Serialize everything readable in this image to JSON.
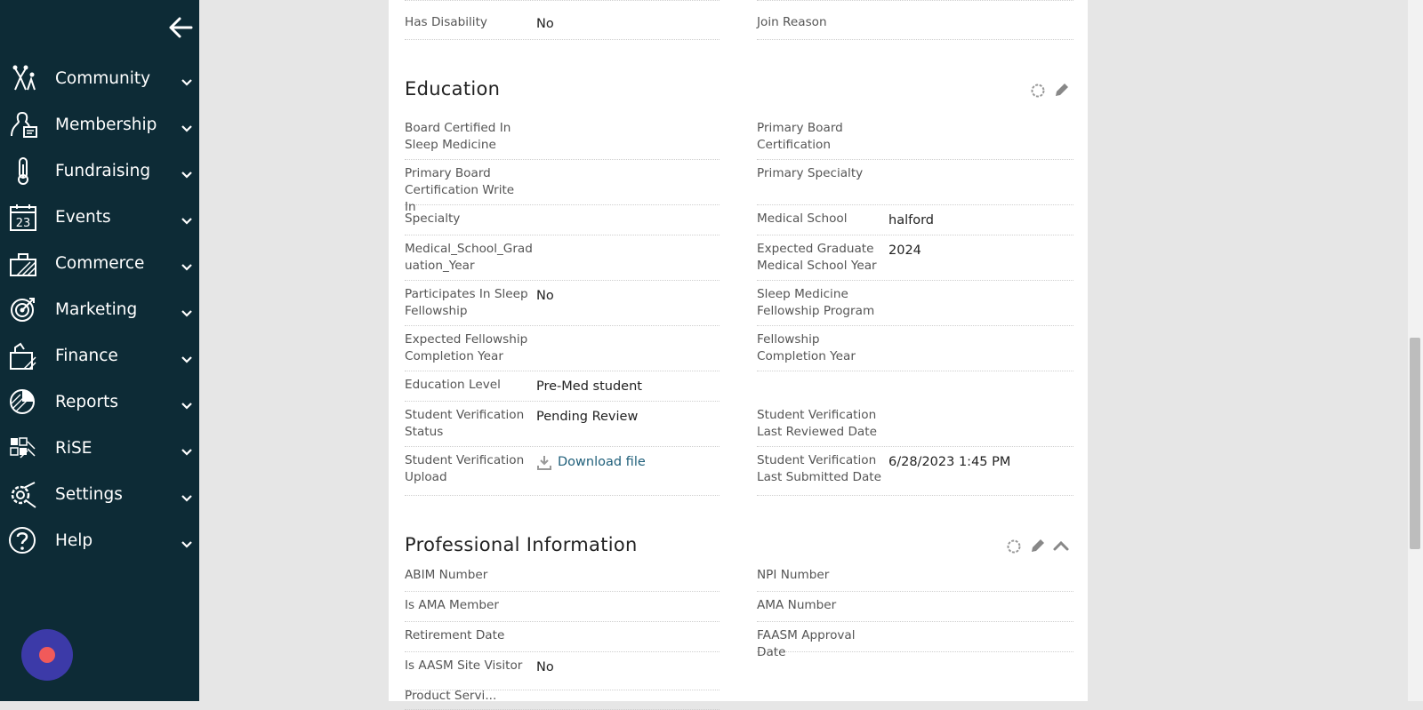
{
  "sidebar": {
    "items": [
      {
        "label": "Community",
        "icon": "community-icon"
      },
      {
        "label": "Membership",
        "icon": "membership-icon"
      },
      {
        "label": "Fundraising",
        "icon": "fundraising-icon"
      },
      {
        "label": "Events",
        "icon": "calendar-icon",
        "icon_text": "23"
      },
      {
        "label": "Commerce",
        "icon": "commerce-icon"
      },
      {
        "label": "Marketing",
        "icon": "target-icon"
      },
      {
        "label": "Finance",
        "icon": "finance-icon"
      },
      {
        "label": "Reports",
        "icon": "pie-chart-icon"
      },
      {
        "label": "RiSE",
        "icon": "puzzle-icon"
      },
      {
        "label": "Settings",
        "icon": "settings-icon"
      },
      {
        "label": "Help",
        "icon": "help-icon"
      }
    ]
  },
  "top_partial": {
    "left_label": "Has Disability",
    "left_value": "No",
    "right_label": "Join Reason"
  },
  "education": {
    "title": "Education",
    "rows": [
      {
        "l_label": "Board Certified In\nSleep Medicine",
        "l_value": "",
        "r_label": "Primary Board\nCertification",
        "r_value": ""
      },
      {
        "l_label": "Primary Board\nCertification Write In",
        "l_value": "",
        "r_label": "Primary Specialty",
        "r_value": ""
      },
      {
        "l_label": "Specialty",
        "l_value": "",
        "r_label": "Medical School",
        "r_value": "halford"
      },
      {
        "l_label": "Medical_School_Grad\nuation_Year",
        "l_value": "",
        "r_label": "Expected Graduate\nMedical School Year",
        "r_value": "2024"
      },
      {
        "l_label": "Participates In Sleep\nFellowship",
        "l_value": "No",
        "r_label": "Sleep Medicine\nFellowship Program",
        "r_value": ""
      },
      {
        "l_label": "Expected Fellowship\nCompletion Year",
        "l_value": "",
        "r_label": "Fellowship\nCompletion Year",
        "r_value": ""
      },
      {
        "l_label": "Education Level",
        "l_value": "Pre-Med student",
        "r_label": "",
        "r_value": ""
      },
      {
        "l_label": "Student Verification\nStatus",
        "l_value": "Pending Review",
        "r_label": "Student Verification\nLast Reviewed Date",
        "r_value": ""
      },
      {
        "l_label": "Student Verification\nUpload",
        "l_value": "Download file",
        "r_label": "Student Verification\nLast Submitted Date",
        "r_value": "6/28/2023 1:45 PM"
      }
    ]
  },
  "professional": {
    "title": "Professional Information",
    "rows": [
      {
        "l_label": "ABIM Number",
        "l_value": "",
        "r_label": "NPI Number",
        "r_value": ""
      },
      {
        "l_label": "Is AMA Member",
        "l_value": "",
        "r_label": "AMA Number",
        "r_value": ""
      },
      {
        "l_label": "Retirement Date",
        "l_value": "",
        "r_label": "FAASM Approval Date",
        "r_value": ""
      },
      {
        "l_label": "Is AASM Site Visitor",
        "l_value": "No",
        "r_label": "",
        "r_value": ""
      },
      {
        "l_label": "Product Servi...",
        "l_value": "",
        "r_label": "",
        "r_value": ""
      }
    ]
  },
  "colors": {
    "sidebar_bg": "#0d2b36",
    "link": "#1f5f7a",
    "bubble": "#3c3aa8",
    "bubble_dot": "#f15a5a"
  }
}
